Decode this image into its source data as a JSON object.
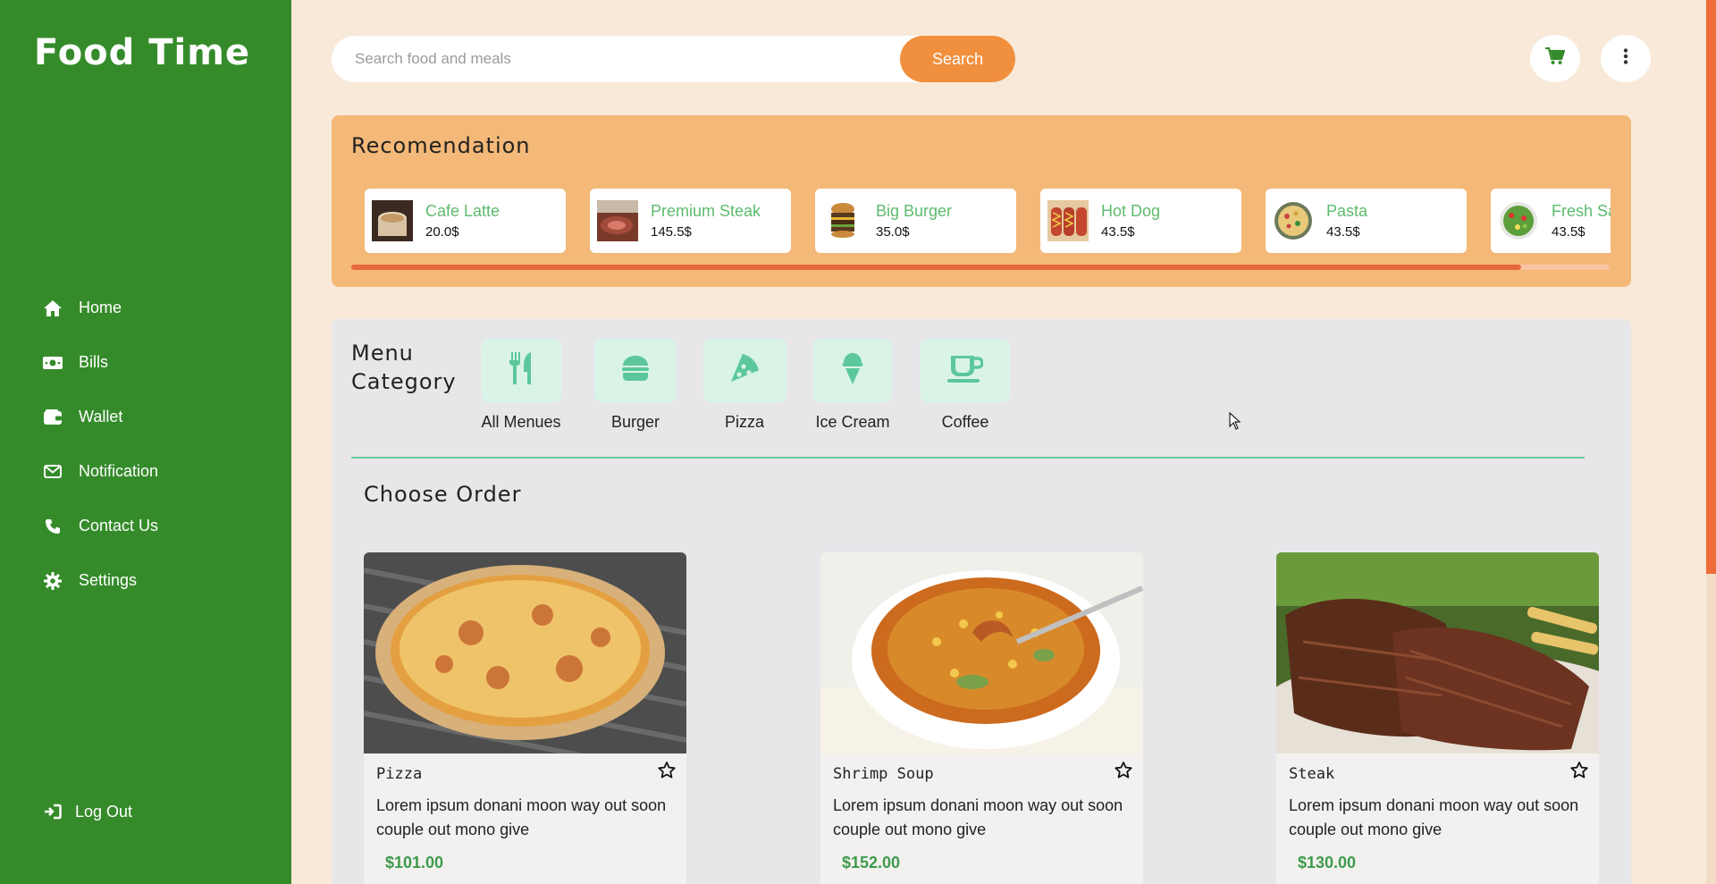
{
  "sidebar": {
    "brand": "Food Time",
    "items": [
      {
        "label": "Home",
        "icon": "home-icon"
      },
      {
        "label": "Bills",
        "icon": "money-icon"
      },
      {
        "label": "Wallet",
        "icon": "wallet-icon"
      },
      {
        "label": "Notification",
        "icon": "envelope-icon"
      },
      {
        "label": "Contact Us",
        "icon": "phone-icon"
      },
      {
        "label": "Settings",
        "icon": "gear-icon"
      }
    ],
    "logout": "Log Out"
  },
  "search": {
    "placeholder": "Search food and meals",
    "value": "",
    "button_label": "Search"
  },
  "header": {
    "cart_icon": "cart-icon",
    "more_icon": "more-vertical-icon"
  },
  "recommendation": {
    "title": "Recomendation",
    "items": [
      {
        "name": "Cafe Latte",
        "price": "20.0$"
      },
      {
        "name": "Premium Steak",
        "price": "145.5$"
      },
      {
        "name": "Big Burger",
        "price": "35.0$"
      },
      {
        "name": "Hot Dog",
        "price": "43.5$"
      },
      {
        "name": "Pasta",
        "price": "43.5$"
      },
      {
        "name": "Fresh Salad",
        "price": "43.5$"
      }
    ],
    "scroll_progress": 0.93
  },
  "menu": {
    "title_line1": "Menu",
    "title_line2": "Category",
    "categories": [
      {
        "label": "All Menues",
        "icon": "utensils-icon"
      },
      {
        "label": "Burger",
        "icon": "burger-icon"
      },
      {
        "label": "Pizza",
        "icon": "pizza-slice-icon"
      },
      {
        "label": "Ice Cream",
        "icon": "ice-cream-icon"
      },
      {
        "label": "Coffee",
        "icon": "coffee-cup-icon"
      }
    ]
  },
  "orders": {
    "title": "Choose Order",
    "items": [
      {
        "name": "Pizza",
        "desc": "Lorem ipsum donani moon way out soon couple out mono give",
        "price": "$101.00"
      },
      {
        "name": "Shrimp Soup",
        "desc": "Lorem ipsum donani moon way out soon couple out mono give",
        "price": "$152.00"
      },
      {
        "name": "Steak",
        "desc": "Lorem ipsum donani moon way out soon couple out mono give",
        "price": "$130.00"
      }
    ]
  },
  "colors": {
    "sidebar": "#358b2a",
    "accent": "#f0903e",
    "recommendation_bg": "#f4b978",
    "price_green": "#3e9a4c",
    "category_bg": "#d9f4e7",
    "category_icon": "#5cc79b"
  }
}
